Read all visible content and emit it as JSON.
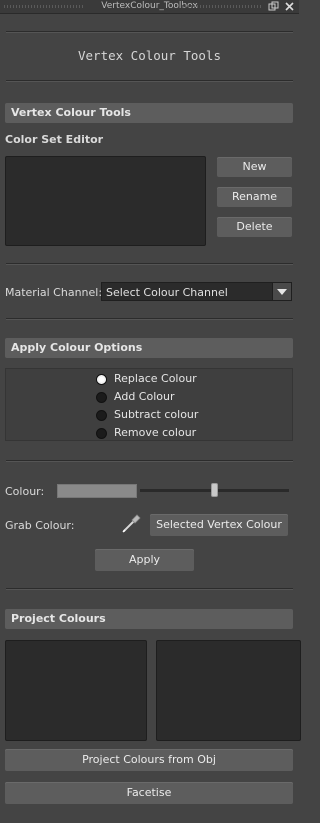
{
  "window": {
    "title": "VertexColour_Toolbox"
  },
  "header": {
    "title": "Vertex Colour Tools"
  },
  "vertex_colour_tools": {
    "frame_label": "Vertex Colour Tools",
    "color_set_editor_label": "Color Set Editor",
    "buttons": {
      "new": "New",
      "rename": "Rename",
      "delete": "Delete"
    }
  },
  "material_channel": {
    "label": "Material Channel:",
    "selected": "Select Colour Channel"
  },
  "apply_colour_options": {
    "frame_label": "Apply Colour Options",
    "options": [
      {
        "label": "Replace Colour",
        "selected": true
      },
      {
        "label": "Add Colour",
        "selected": false
      },
      {
        "label": "Subtract colour",
        "selected": false
      },
      {
        "label": "Remove colour",
        "selected": false
      }
    ]
  },
  "colour": {
    "label": "Colour:",
    "swatch_color": "#8a8a8a",
    "slider_value_fraction": 0.52
  },
  "grab_colour": {
    "label": "Grab Colour:",
    "icon": "eyedropper-icon",
    "button": "Selected Vertex Colour"
  },
  "apply_button": "Apply",
  "project_colours": {
    "frame_label": "Project Colours",
    "project_button": "Project Colours from Obj",
    "facetise_button": "Facetise"
  },
  "colors": {
    "background": "#444444",
    "frame": "#5d5d5d",
    "list_bg": "#2b2b2b",
    "button": "#5d5d5d"
  }
}
